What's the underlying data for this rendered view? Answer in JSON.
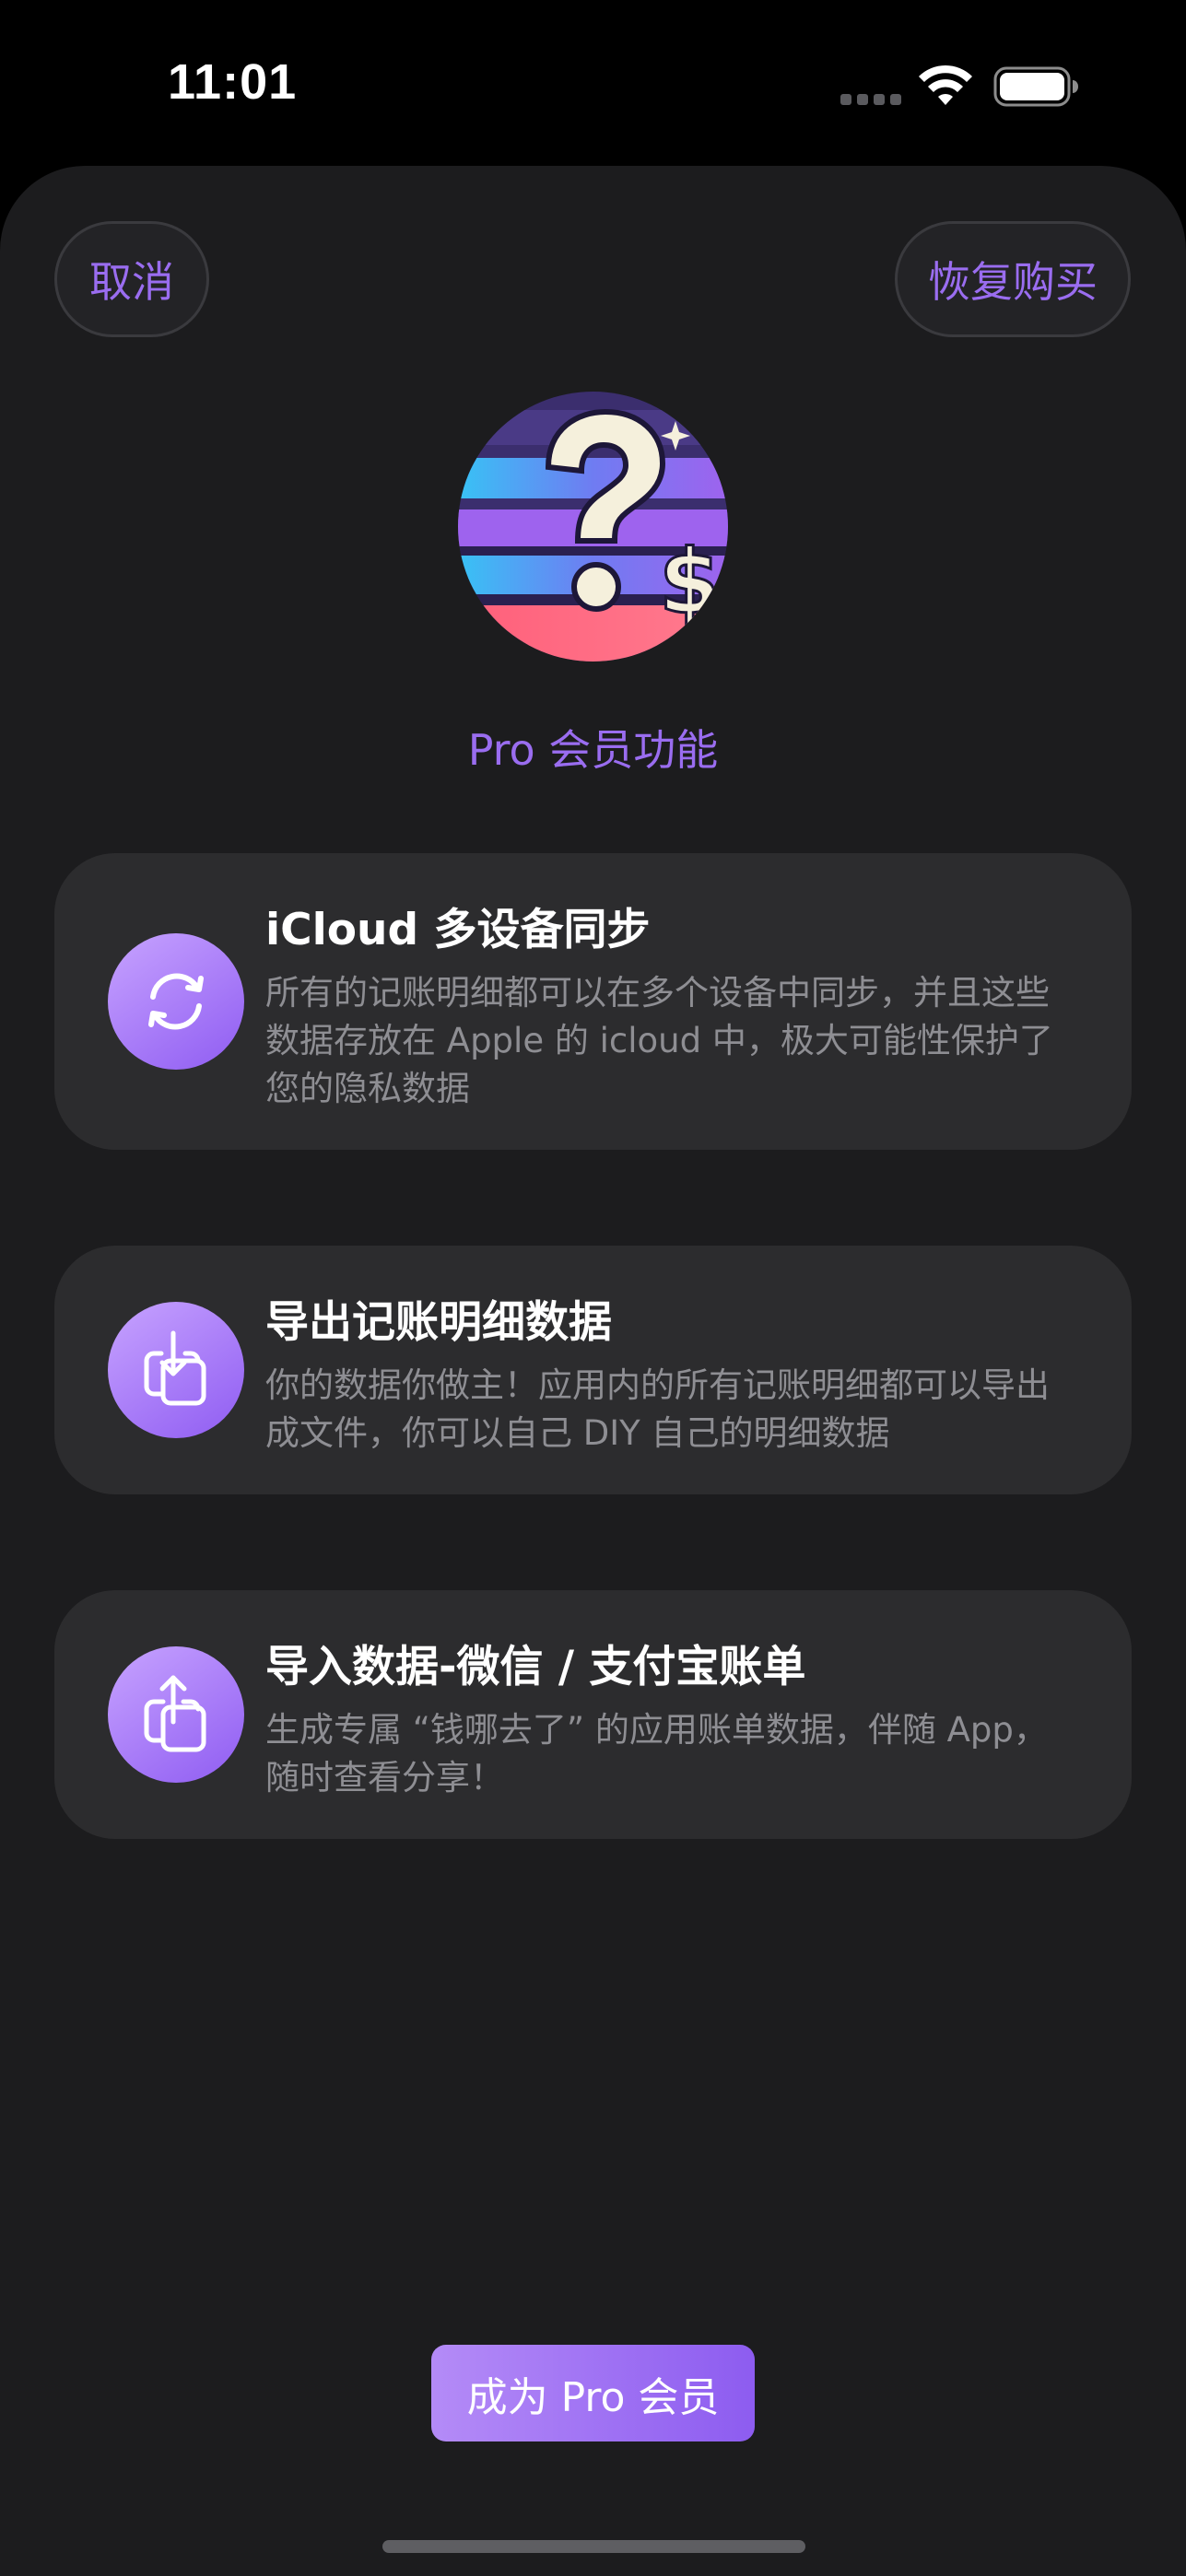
{
  "status_bar": {
    "time": "11:01"
  },
  "header": {
    "cancel_label": "取消",
    "restore_label": "恢复购买"
  },
  "hero": {
    "title": "Pro 会员功能"
  },
  "features": [
    {
      "icon": "sync-icon",
      "title": "iCloud 多设备同步",
      "description": "所有的记账明细都可以在多个设备中同步，并且这些数据存放在 Apple 的 icloud 中，极大可能性保护了您的隐私数据"
    },
    {
      "icon": "export-icon",
      "title": "导出记账明细数据",
      "description": "你的数据你做主！应用内的所有记账明细都可以导出成文件，你可以自己 DIY 自己的明细数据"
    },
    {
      "icon": "import-icon",
      "title": "导入数据-微信 / 支付宝账单",
      "description": "生成专属 “钱哪去了” 的应用账单数据，伴随 App，随时查看分享！"
    }
  ],
  "cta": {
    "label": "成为 Pro 会员"
  },
  "colors": {
    "accent": "#9a6df0",
    "sheet_background": "#1c1c1e",
    "card_background": "#2c2c2e",
    "secondary_text": "#8e8e93"
  }
}
